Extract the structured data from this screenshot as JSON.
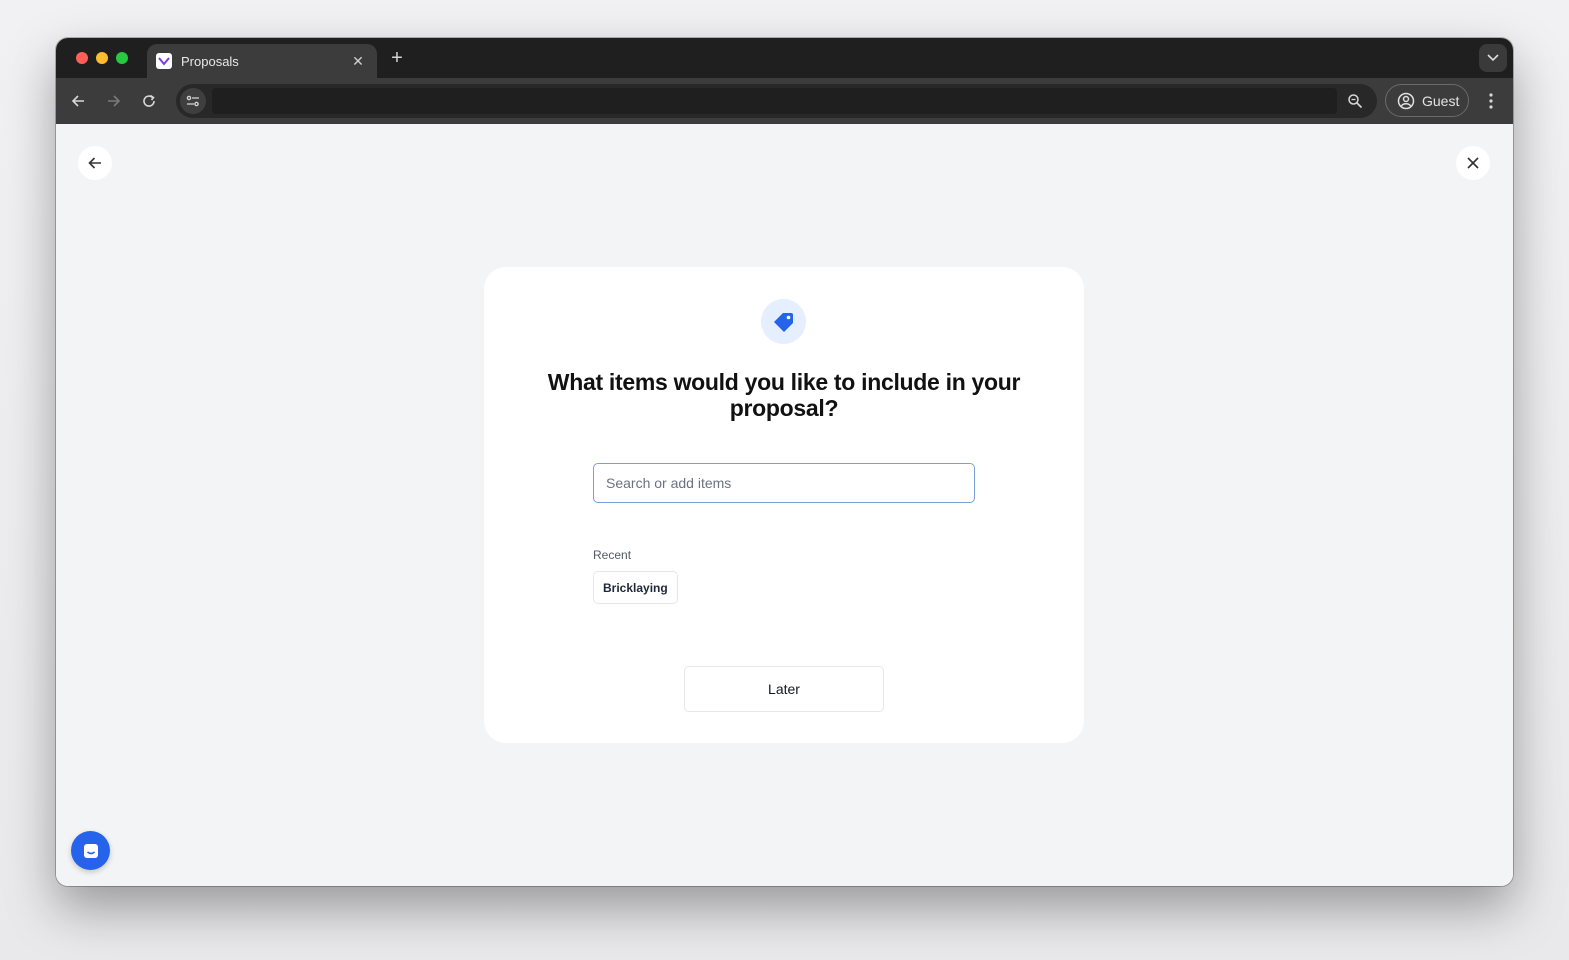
{
  "browser": {
    "tab": {
      "title": "Proposals",
      "favicon": "proposals-logo-icon"
    },
    "new_tab_icon": "plus-icon",
    "url": "",
    "profile": {
      "label": "Guest",
      "icon": "account-circle-icon"
    }
  },
  "modal": {
    "icon": "tag-icon",
    "title": "What items would you like to include in your proposal?",
    "search": {
      "placeholder": "Search or add items",
      "value": ""
    },
    "recent_label": "Recent",
    "recent_items": [
      "Bricklaying"
    ],
    "later_button": "Later"
  },
  "colors": {
    "accent": "#2563eb",
    "accent_light": "#e5efff",
    "page_background": "#f3f4f6",
    "card_background": "#ffffff",
    "tab_strip": "#1f1f1f",
    "toolbar": "#3c3c3c"
  }
}
